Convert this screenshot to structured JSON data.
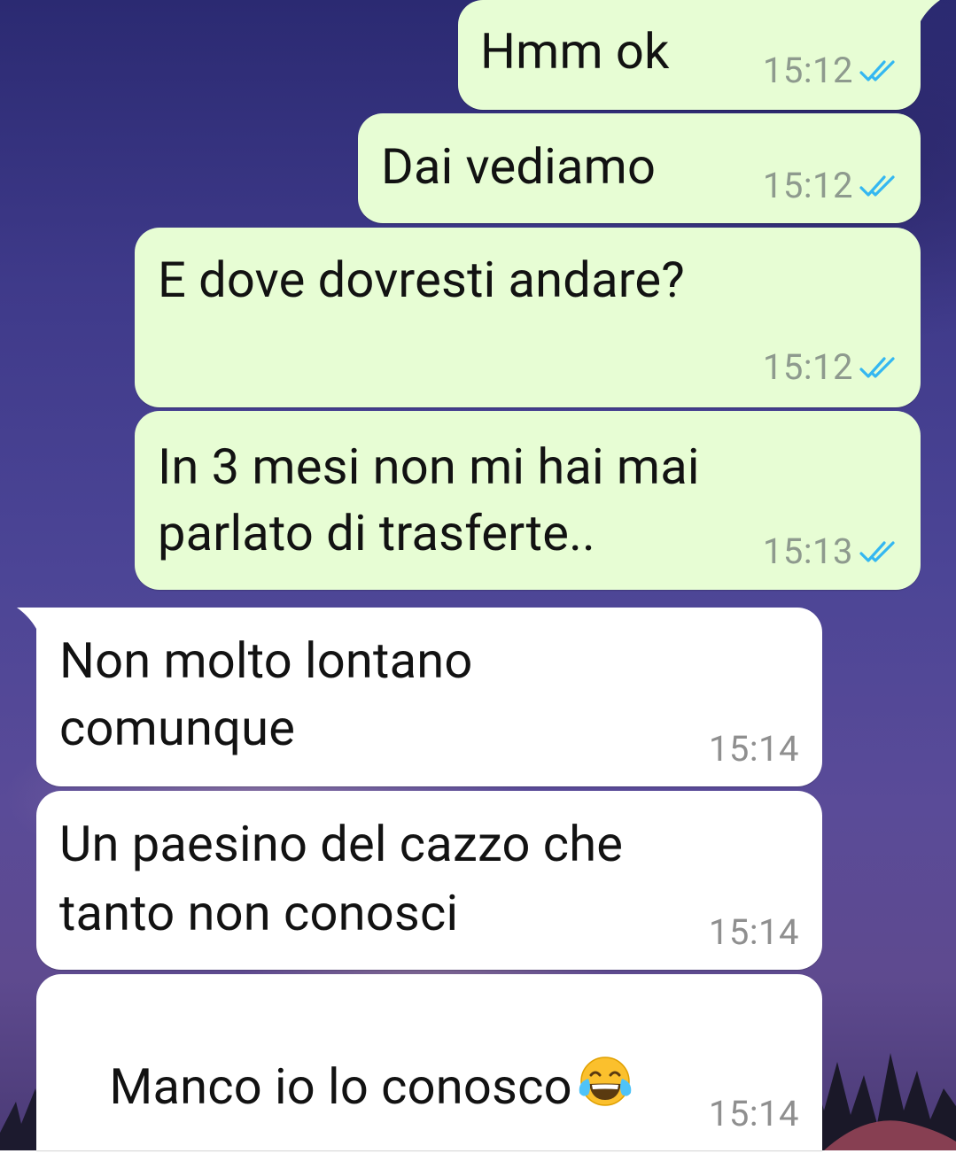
{
  "chat": {
    "messages": [
      {
        "direction": "outgoing",
        "text": "Hmm ok",
        "time": "15:12",
        "status": "read"
      },
      {
        "direction": "outgoing",
        "text": "Dai vediamo",
        "time": "15:12",
        "status": "read"
      },
      {
        "direction": "outgoing",
        "text": "E dove dovresti andare?",
        "time": "15:12",
        "status": "read"
      },
      {
        "direction": "outgoing",
        "text_line1": "In 3 mesi non mi hai mai",
        "text_line2": "parlato di trasferte..",
        "time": "15:13",
        "status": "read"
      },
      {
        "direction": "incoming",
        "text_line1": "Non molto lontano",
        "text_line2": "comunque",
        "time": "15:14"
      },
      {
        "direction": "incoming",
        "text_line1": "Un paesino del cazzo che",
        "text_line2": "tanto non conosci",
        "time": "15:14"
      },
      {
        "direction": "incoming",
        "text": "Manco io lo conosco",
        "emoji": "face-with-tears-of-joy",
        "time": "15:14"
      }
    ]
  },
  "colors": {
    "outgoing_bubble": "#e7fdd4",
    "incoming_bubble": "#ffffff",
    "read_ticks": "#34b7f1",
    "wallpaper_top": "#2b2a72",
    "wallpaper_bottom": "#5e4a8f"
  },
  "icons": {
    "read_receipt": "double-check-icon",
    "emoji": "face-with-tears-of-joy-emoji"
  }
}
